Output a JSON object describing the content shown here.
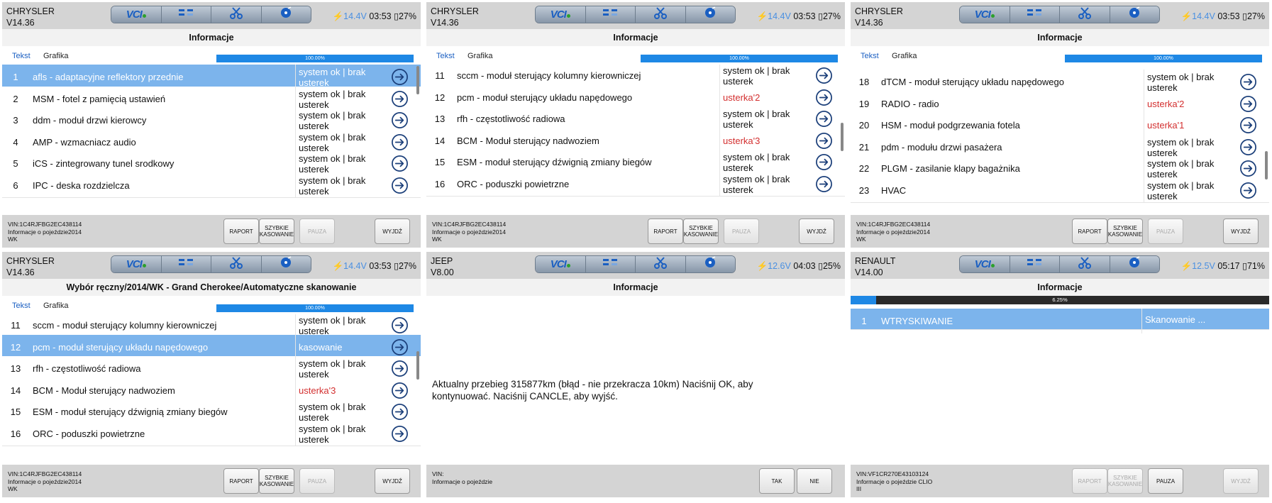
{
  "panels": [
    {
      "brand": "CHRYSLER",
      "version": "V14.36",
      "voltage": "14.4V",
      "time": "03:53",
      "battery": "27%",
      "title": "Informacje",
      "tabs": [
        "Tekst",
        "Grafika"
      ],
      "progress": "100.00%",
      "rows": [
        {
          "num": "1",
          "name": "afls - adaptacyjne reflektory przednie",
          "status": "system ok | brak usterek",
          "err": false,
          "hl": true
        },
        {
          "num": "2",
          "name": "MSM - fotel z pamięcią ustawień",
          "status": "system ok | brak usterek",
          "err": false
        },
        {
          "num": "3",
          "name": "ddm - moduł drzwi kierowcy",
          "status": "system ok | brak usterek",
          "err": false
        },
        {
          "num": "4",
          "name": "AMP - wzmacniacz audio",
          "status": "system ok | brak usterek",
          "err": false
        },
        {
          "num": "5",
          "name": "iCS - zintegrowany tunel srodkowy",
          "status": "system ok | brak usterek",
          "err": false
        },
        {
          "num": "6",
          "name": "IPC - deska rozdzielcza",
          "status": "system ok | brak usterek",
          "err": false
        }
      ],
      "vin": "VIN:1C4RJFBG2EC438114",
      "info": "Informacje o pojeździe2014",
      "info2": "WK",
      "buttons": [
        {
          "label": "RAPORT"
        },
        {
          "label": "SZYBKIE KASOWANIE"
        },
        {
          "label": "PAUZA",
          "dis": true
        },
        {
          "label": "WYJDŹ"
        }
      ]
    },
    {
      "brand": "CHRYSLER",
      "version": "V14.36",
      "voltage": "14.4V",
      "time": "03:53",
      "battery": "27%",
      "title": "Informacje",
      "tabs": [
        "Tekst",
        "Grafika"
      ],
      "progress": "100.00%",
      "rows": [
        {
          "num": "11",
          "name": "sccm - moduł sterujący kolumny kierowniczej",
          "status": "system ok | brak usterek",
          "err": false
        },
        {
          "num": "12",
          "name": "pcm - moduł sterujący układu napędowego",
          "status": "usterka'2",
          "err": true
        },
        {
          "num": "13",
          "name": "rfh - częstotliwość radiowa",
          "status": "system ok | brak usterek",
          "err": false
        },
        {
          "num": "14",
          "name": "BCM - Moduł sterujący nadwoziem",
          "status": "usterka'3",
          "err": true
        },
        {
          "num": "15",
          "name": "ESM - moduł sterujący dźwignią zmiany biegów",
          "status": "system ok | brak usterek",
          "err": false
        },
        {
          "num": "16",
          "name": "ORC - poduszki powietrzne",
          "status": "system ok | brak usterek",
          "err": false
        }
      ],
      "vin": "VIN:1C4RJFBG2EC438114",
      "info": "Informacje o pojeździe2014",
      "info2": "WK",
      "buttons": [
        {
          "label": "RAPORT"
        },
        {
          "label": "SZYBKIE KASOWANIE"
        },
        {
          "label": "PAUZA",
          "dis": true
        },
        {
          "label": "WYJDŹ"
        }
      ]
    },
    {
      "brand": "CHRYSLER",
      "version": "V14.36",
      "voltage": "14.4V",
      "time": "03:53",
      "battery": "27%",
      "title": "Informacje",
      "tabs": [
        "Tekst",
        "Grafika"
      ],
      "progress": "100.00%",
      "rows": [
        {
          "num": "18",
          "name": "dTCM - moduł sterujący układu napędowego",
          "status": "system ok | brak usterek",
          "err": false
        },
        {
          "num": "19",
          "name": "RADIO - radio",
          "status": "usterka'2",
          "err": true
        },
        {
          "num": "20",
          "name": "HSM - moduł podgrzewania fotela",
          "status": "usterka'1",
          "err": true
        },
        {
          "num": "21",
          "name": "pdm - modułu drzwi pasażera",
          "status": "system ok | brak usterek",
          "err": false
        },
        {
          "num": "22",
          "name": "PLGM - zasilanie klapy bagażnika",
          "status": "system ok | brak usterek",
          "err": false
        },
        {
          "num": "23",
          "name": "HVAC",
          "status": "system ok | brak usterek",
          "err": false
        }
      ],
      "vin": "VIN:1C4RJFBG2EC438114",
      "info": "Informacje o pojeździe2014",
      "info2": "WK",
      "buttons": [
        {
          "label": "RAPORT"
        },
        {
          "label": "SZYBKIE KASOWANIE"
        },
        {
          "label": "PAUZA",
          "dis": true
        },
        {
          "label": "WYJDŹ"
        }
      ]
    },
    {
      "brand": "CHRYSLER",
      "version": "V14.36",
      "voltage": "14.4V",
      "time": "03:53",
      "battery": "27%",
      "title": "Wybór ręczny/2014/WK - Grand Cherokee/Automatyczne skanowanie",
      "tabs": [
        "Tekst",
        "Grafika"
      ],
      "progress": "100.00%",
      "rows": [
        {
          "num": "11",
          "name": "sccm - moduł sterujący kolumny kierowniczej",
          "status": "system ok | brak usterek",
          "err": false
        },
        {
          "num": "12",
          "name": "pcm - moduł sterujący układu napędowego",
          "status": "kasowanie",
          "err": false,
          "hl": true
        },
        {
          "num": "13",
          "name": "rfh - częstotliwość radiowa",
          "status": "system ok | brak usterek",
          "err": false
        },
        {
          "num": "14",
          "name": "BCM - Moduł sterujący nadwoziem",
          "status": "usterka'3",
          "err": true
        },
        {
          "num": "15",
          "name": "ESM - moduł sterujący dźwignią zmiany biegów",
          "status": "system ok | brak usterek",
          "err": false
        },
        {
          "num": "16",
          "name": "ORC - poduszki powietrzne",
          "status": "system ok | brak usterek",
          "err": false
        }
      ],
      "vin": "VIN:1C4RJFBG2EC438114",
      "info": "Informacje o pojeździe2014",
      "info2": "WK",
      "buttons": [
        {
          "label": "RAPORT"
        },
        {
          "label": "SZYBKIE KASOWANIE"
        },
        {
          "label": "PAUZA",
          "dis": true
        },
        {
          "label": "WYJDŹ"
        }
      ]
    },
    {
      "brand": "JEEP",
      "version": "V8.00",
      "voltage": "12.6V",
      "time": "04:03",
      "battery": "25%",
      "title": "Informacje",
      "message": "Aktualny przebieg 315877km (błąd - nie przekracza 10km) Naciśnij OK, aby kontynuować. Naciśnij CANCLE, aby wyjść.",
      "vin": "VIN:",
      "info": "Informacje o pojeździe",
      "info2": "",
      "buttons": [
        {
          "label": "TAK"
        },
        {
          "label": "NIE"
        }
      ]
    },
    {
      "brand": "RENAULT",
      "version": "V14.00",
      "voltage": "12.5V",
      "time": "05:17",
      "battery": "71%",
      "title": "Informacje",
      "progress": "6.25%",
      "rows": [
        {
          "num": "1",
          "name": "WTRYSKIWANIE",
          "status": "Skanowanie ...",
          "err": false,
          "hl": true,
          "noarrow": true
        }
      ],
      "vin": "VIN:VF1CR270E43103124",
      "info": "Informacje o pojeździe CLIO",
      "info2": "III",
      "buttons": [
        {
          "label": "RAPORT",
          "dis": true
        },
        {
          "label": "SZYBKIE KASOWANIE",
          "dis": true
        },
        {
          "label": "PAUZA"
        },
        {
          "label": "WYJDŹ",
          "dis": true
        }
      ]
    }
  ]
}
